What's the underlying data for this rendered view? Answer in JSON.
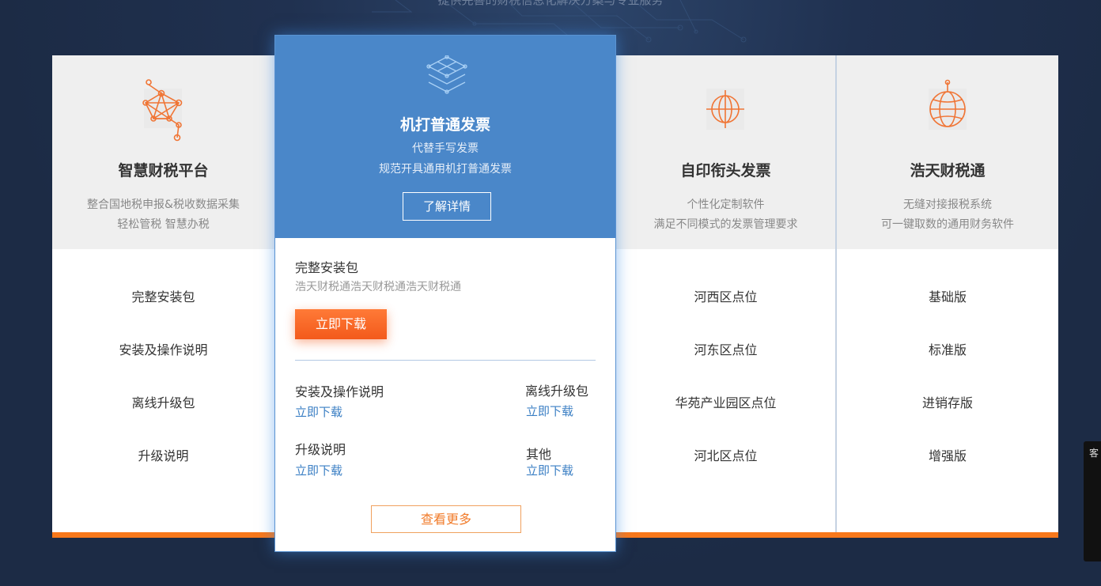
{
  "top_text": "提供完善的财税信息化解决方案与专业服务",
  "cards": [
    {
      "title": "智慧财税平台",
      "desc": [
        "整合国地税申报&税收数据采集",
        "轻松管税  智慧办税"
      ],
      "items": [
        "完整安装包",
        "安装及操作说明",
        "离线升级包",
        "升级说明"
      ],
      "icon": "network-graph-icon"
    },
    {
      "title": "自印衔头发票",
      "desc": [
        "个性化定制软件",
        "满足不同模式的发票管理要求"
      ],
      "items": [
        "河西区点位",
        "河东区点位",
        "华苑产业园区点位",
        "河北区点位"
      ],
      "icon": "crosshair-globe-icon"
    },
    {
      "title": "浩天财税通",
      "desc": [
        "无缝对接报税系统",
        "可一键取数的通用财务软件"
      ],
      "items": [
        "基础版",
        "标准版",
        "进销存版",
        "增强版"
      ],
      "icon": "globe-icon"
    }
  ],
  "featured": {
    "icon": "layered-network-icon",
    "title": "机打普通发票",
    "subtitle": [
      "代替手写发票",
      "规范开具通用机打普通发票"
    ],
    "detail_button": "了解详情",
    "package_title": "完整安装包",
    "package_desc": "浩天财税通浩天财税通浩天财税通",
    "download_button": "立即下载",
    "downloads": [
      {
        "name": "安装及操作说明",
        "link": "立即下载"
      },
      {
        "name": "离线升级包",
        "link": "立即下载"
      },
      {
        "name": "升级说明",
        "link": "立即下载"
      },
      {
        "name": "其他",
        "link": "立即下载"
      }
    ],
    "more_button": "查看更多"
  },
  "side_widget": {
    "label": "客"
  },
  "colors": {
    "background": "#1c2b45",
    "featured_blue": "#4a87c9",
    "accent_orange": "#f7781b",
    "link_blue": "#3b7fc4",
    "card_header_gray": "#efefef"
  }
}
